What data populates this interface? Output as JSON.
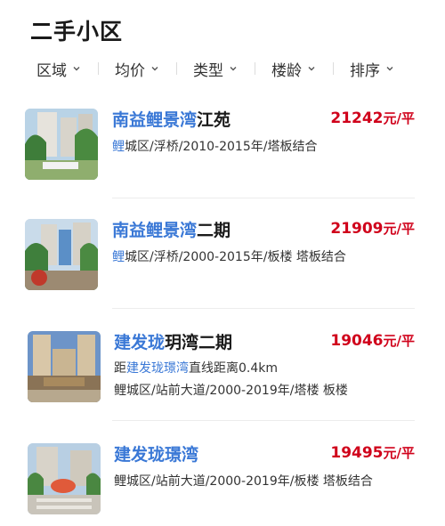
{
  "header": {
    "title": "二手小区"
  },
  "filters": [
    {
      "label": "区域"
    },
    {
      "label": "均价"
    },
    {
      "label": "类型"
    },
    {
      "label": "楼龄"
    },
    {
      "label": "排序"
    }
  ],
  "colors": {
    "accent": "#3a78d6",
    "price": "#d0021b"
  },
  "listings": [
    {
      "title_highlight": "南益鲤景湾",
      "title_rest": "江苑",
      "price": "21242",
      "price_unit": "元/平",
      "meta1_highlight": "鲤",
      "meta1_rest": "城区/浮桥/2010-2015年/塔板结合"
    },
    {
      "title_highlight": "南益鲤景湾",
      "title_rest": "二期",
      "price": "21909",
      "price_unit": "元/平",
      "meta1_highlight": "鲤",
      "meta1_rest": "城区/浮桥/2000-2015年/板楼 塔板结合"
    },
    {
      "title_highlight": "建发珑",
      "title_rest": "玥湾二期",
      "price": "19046",
      "price_unit": "元/平",
      "meta1_prefix": "距",
      "meta1_highlight": "建发珑璟湾",
      "meta1_rest": "直线距离0.4km",
      "meta2": "鲤城区/站前大道/2000-2019年/塔楼 板楼"
    },
    {
      "title_highlight": "建发珑璟湾",
      "title_rest": "",
      "price": "19495",
      "price_unit": "元/平",
      "meta1": "鲤城区/站前大道/2000-2019年/板楼 塔板结合"
    }
  ]
}
